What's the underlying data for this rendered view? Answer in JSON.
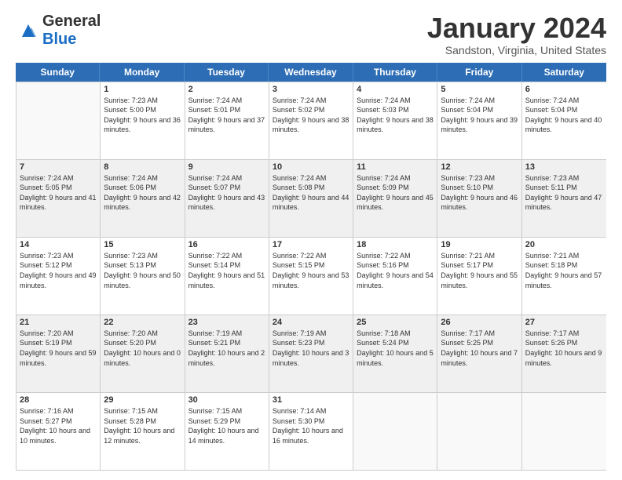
{
  "logo": {
    "general": "General",
    "blue": "Blue"
  },
  "title": "January 2024",
  "subtitle": "Sandston, Virginia, United States",
  "weekdays": [
    "Sunday",
    "Monday",
    "Tuesday",
    "Wednesday",
    "Thursday",
    "Friday",
    "Saturday"
  ],
  "rows": [
    [
      {
        "day": "",
        "sunrise": "",
        "sunset": "",
        "daylight": "",
        "empty": true
      },
      {
        "day": "1",
        "sunrise": "Sunrise: 7:23 AM",
        "sunset": "Sunset: 5:00 PM",
        "daylight": "Daylight: 9 hours and 36 minutes.",
        "empty": false
      },
      {
        "day": "2",
        "sunrise": "Sunrise: 7:24 AM",
        "sunset": "Sunset: 5:01 PM",
        "daylight": "Daylight: 9 hours and 37 minutes.",
        "empty": false
      },
      {
        "day": "3",
        "sunrise": "Sunrise: 7:24 AM",
        "sunset": "Sunset: 5:02 PM",
        "daylight": "Daylight: 9 hours and 38 minutes.",
        "empty": false
      },
      {
        "day": "4",
        "sunrise": "Sunrise: 7:24 AM",
        "sunset": "Sunset: 5:03 PM",
        "daylight": "Daylight: 9 hours and 38 minutes.",
        "empty": false
      },
      {
        "day": "5",
        "sunrise": "Sunrise: 7:24 AM",
        "sunset": "Sunset: 5:04 PM",
        "daylight": "Daylight: 9 hours and 39 minutes.",
        "empty": false
      },
      {
        "day": "6",
        "sunrise": "Sunrise: 7:24 AM",
        "sunset": "Sunset: 5:04 PM",
        "daylight": "Daylight: 9 hours and 40 minutes.",
        "empty": false
      }
    ],
    [
      {
        "day": "7",
        "sunrise": "Sunrise: 7:24 AM",
        "sunset": "Sunset: 5:05 PM",
        "daylight": "Daylight: 9 hours and 41 minutes.",
        "empty": false
      },
      {
        "day": "8",
        "sunrise": "Sunrise: 7:24 AM",
        "sunset": "Sunset: 5:06 PM",
        "daylight": "Daylight: 9 hours and 42 minutes.",
        "empty": false
      },
      {
        "day": "9",
        "sunrise": "Sunrise: 7:24 AM",
        "sunset": "Sunset: 5:07 PM",
        "daylight": "Daylight: 9 hours and 43 minutes.",
        "empty": false
      },
      {
        "day": "10",
        "sunrise": "Sunrise: 7:24 AM",
        "sunset": "Sunset: 5:08 PM",
        "daylight": "Daylight: 9 hours and 44 minutes.",
        "empty": false
      },
      {
        "day": "11",
        "sunrise": "Sunrise: 7:24 AM",
        "sunset": "Sunset: 5:09 PM",
        "daylight": "Daylight: 9 hours and 45 minutes.",
        "empty": false
      },
      {
        "day": "12",
        "sunrise": "Sunrise: 7:23 AM",
        "sunset": "Sunset: 5:10 PM",
        "daylight": "Daylight: 9 hours and 46 minutes.",
        "empty": false
      },
      {
        "day": "13",
        "sunrise": "Sunrise: 7:23 AM",
        "sunset": "Sunset: 5:11 PM",
        "daylight": "Daylight: 9 hours and 47 minutes.",
        "empty": false
      }
    ],
    [
      {
        "day": "14",
        "sunrise": "Sunrise: 7:23 AM",
        "sunset": "Sunset: 5:12 PM",
        "daylight": "Daylight: 9 hours and 49 minutes.",
        "empty": false
      },
      {
        "day": "15",
        "sunrise": "Sunrise: 7:23 AM",
        "sunset": "Sunset: 5:13 PM",
        "daylight": "Daylight: 9 hours and 50 minutes.",
        "empty": false
      },
      {
        "day": "16",
        "sunrise": "Sunrise: 7:22 AM",
        "sunset": "Sunset: 5:14 PM",
        "daylight": "Daylight: 9 hours and 51 minutes.",
        "empty": false
      },
      {
        "day": "17",
        "sunrise": "Sunrise: 7:22 AM",
        "sunset": "Sunset: 5:15 PM",
        "daylight": "Daylight: 9 hours and 53 minutes.",
        "empty": false
      },
      {
        "day": "18",
        "sunrise": "Sunrise: 7:22 AM",
        "sunset": "Sunset: 5:16 PM",
        "daylight": "Daylight: 9 hours and 54 minutes.",
        "empty": false
      },
      {
        "day": "19",
        "sunrise": "Sunrise: 7:21 AM",
        "sunset": "Sunset: 5:17 PM",
        "daylight": "Daylight: 9 hours and 55 minutes.",
        "empty": false
      },
      {
        "day": "20",
        "sunrise": "Sunrise: 7:21 AM",
        "sunset": "Sunset: 5:18 PM",
        "daylight": "Daylight: 9 hours and 57 minutes.",
        "empty": false
      }
    ],
    [
      {
        "day": "21",
        "sunrise": "Sunrise: 7:20 AM",
        "sunset": "Sunset: 5:19 PM",
        "daylight": "Daylight: 9 hours and 59 minutes.",
        "empty": false
      },
      {
        "day": "22",
        "sunrise": "Sunrise: 7:20 AM",
        "sunset": "Sunset: 5:20 PM",
        "daylight": "Daylight: 10 hours and 0 minutes.",
        "empty": false
      },
      {
        "day": "23",
        "sunrise": "Sunrise: 7:19 AM",
        "sunset": "Sunset: 5:21 PM",
        "daylight": "Daylight: 10 hours and 2 minutes.",
        "empty": false
      },
      {
        "day": "24",
        "sunrise": "Sunrise: 7:19 AM",
        "sunset": "Sunset: 5:23 PM",
        "daylight": "Daylight: 10 hours and 3 minutes.",
        "empty": false
      },
      {
        "day": "25",
        "sunrise": "Sunrise: 7:18 AM",
        "sunset": "Sunset: 5:24 PM",
        "daylight": "Daylight: 10 hours and 5 minutes.",
        "empty": false
      },
      {
        "day": "26",
        "sunrise": "Sunrise: 7:17 AM",
        "sunset": "Sunset: 5:25 PM",
        "daylight": "Daylight: 10 hours and 7 minutes.",
        "empty": false
      },
      {
        "day": "27",
        "sunrise": "Sunrise: 7:17 AM",
        "sunset": "Sunset: 5:26 PM",
        "daylight": "Daylight: 10 hours and 9 minutes.",
        "empty": false
      }
    ],
    [
      {
        "day": "28",
        "sunrise": "Sunrise: 7:16 AM",
        "sunset": "Sunset: 5:27 PM",
        "daylight": "Daylight: 10 hours and 10 minutes.",
        "empty": false
      },
      {
        "day": "29",
        "sunrise": "Sunrise: 7:15 AM",
        "sunset": "Sunset: 5:28 PM",
        "daylight": "Daylight: 10 hours and 12 minutes.",
        "empty": false
      },
      {
        "day": "30",
        "sunrise": "Sunrise: 7:15 AM",
        "sunset": "Sunset: 5:29 PM",
        "daylight": "Daylight: 10 hours and 14 minutes.",
        "empty": false
      },
      {
        "day": "31",
        "sunrise": "Sunrise: 7:14 AM",
        "sunset": "Sunset: 5:30 PM",
        "daylight": "Daylight: 10 hours and 16 minutes.",
        "empty": false
      },
      {
        "day": "",
        "sunrise": "",
        "sunset": "",
        "daylight": "",
        "empty": true
      },
      {
        "day": "",
        "sunrise": "",
        "sunset": "",
        "daylight": "",
        "empty": true
      },
      {
        "day": "",
        "sunrise": "",
        "sunset": "",
        "daylight": "",
        "empty": true
      }
    ]
  ],
  "colors": {
    "header_bg": "#2d6db5",
    "header_text": "#ffffff",
    "border": "#cccccc",
    "shade_row": "#f0f0f0"
  }
}
